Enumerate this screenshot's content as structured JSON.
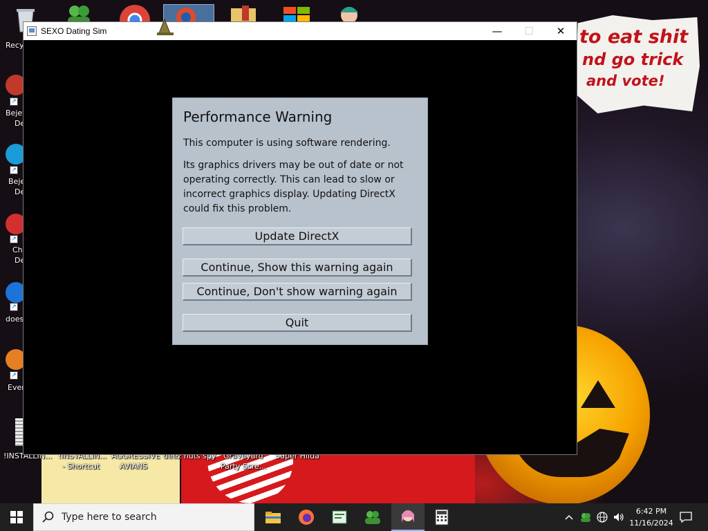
{
  "window": {
    "title": "SEXO Dating Sim",
    "minimize_glyph": "—",
    "maximize_glyph": "☐",
    "close_glyph": "✕"
  },
  "dialog": {
    "title": "Performance Warning",
    "message_1": "This computer is using software rendering.",
    "message_2": "Its graphics drivers may be out of date or not operating correctly. This can lead to slow or incorrect graphics display. Updating DirectX could fix this problem.",
    "buttons": {
      "update": "Update DirectX",
      "continue_show": "Continue, Show this warning again",
      "continue_dont": "Continue, Don't show warning again",
      "quit": "Quit"
    }
  },
  "wallpaper": {
    "note_line_1": "to eat shit",
    "note_line_2": "nd go trick",
    "note_line_3": "and vote!"
  },
  "desktop_icons": {
    "left_labels": [
      "Recy",
      "Bejev",
      "De",
      "Beje",
      "De",
      "Ch",
      "De",
      "does",
      "Ever"
    ],
    "bottom_labels": [
      "!INSTALLIN...",
      "!INSTALLIN...",
      "- Shortcut",
      "AGGRESSIVE",
      "AVIANS",
      "deez nuts spy",
      "Graveyard",
      "Party Scre...",
      "Super Hilda"
    ]
  },
  "taskbar": {
    "search_placeholder": "Type here to search",
    "apps": [
      "file-explorer",
      "firefox",
      "notepad-app",
      "people-app",
      "anime-game",
      "calculator"
    ],
    "clock_time": "6:42 PM",
    "clock_date": "11/16/2024"
  }
}
